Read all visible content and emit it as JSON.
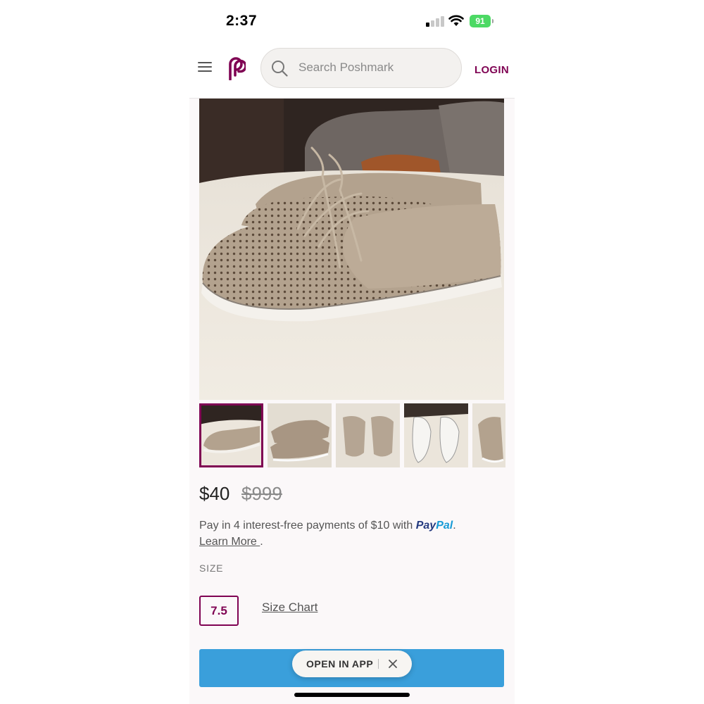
{
  "status_bar": {
    "time": "2:37",
    "battery_level": "91",
    "signal_bars_active": 1,
    "signal_bars_total": 4
  },
  "header": {
    "menu_icon": "hamburger-menu-icon",
    "logo_icon": "poshmark-logo-icon",
    "search_placeholder": "Search Poshmark",
    "login_label": "LOGIN"
  },
  "listing": {
    "main_image": "tan perforated suede lace-up oxford shoes on white blanket",
    "thumbnails": [
      {
        "label": "thumbnail-1",
        "selected": true
      },
      {
        "label": "thumbnail-2",
        "selected": false
      },
      {
        "label": "thumbnail-3",
        "selected": false
      },
      {
        "label": "thumbnail-4",
        "selected": false
      },
      {
        "label": "thumbnail-5",
        "selected": false
      }
    ],
    "price": "$40",
    "original_price": "$999",
    "payment_text": "Pay in 4 interest-free payments of $10 with",
    "paypal_part1": "Pay",
    "paypal_part2": "Pal",
    "payment_period": ".",
    "learn_more": "Learn More ",
    "learn_more_period": ".",
    "size_label": "SIZE",
    "size_value": "7.5",
    "size_chart_label": "Size Chart"
  },
  "banner": {
    "open_in_app_label": "OPEN IN APP",
    "close_icon": "close-icon"
  },
  "colors": {
    "brand": "#7f0353",
    "buy_button": "#3a9fdb",
    "battery": "#4cd964"
  }
}
